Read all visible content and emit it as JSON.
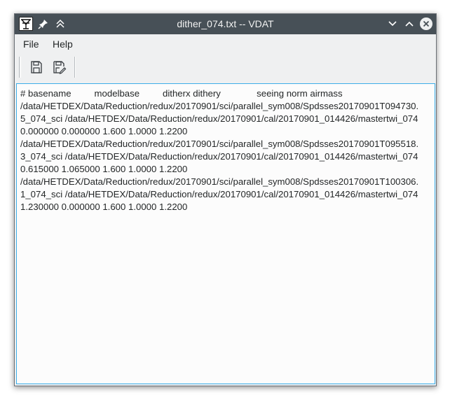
{
  "window": {
    "title": "dither_074.txt -- VDAT"
  },
  "menubar": {
    "file_label": "File",
    "help_label": "Help"
  },
  "toolbar": {
    "save_icon": "save-icon",
    "save_as_icon": "save-as-icon"
  },
  "editor": {
    "lines": [
      "# basename         modelbase         ditherx dithery              seeing norm airmass",
      "/data/HETDEX/Data/Reduction/redux/20170901/sci/parallel_sym008/Spdsses20170901T094730.",
      "5_074_sci /data/HETDEX/Data/Reduction/redux/20170901/cal/20170901_014426/mastertwi_074",
      "0.000000 0.000000 1.600 1.0000 1.2200",
      "/data/HETDEX/Data/Reduction/redux/20170901/sci/parallel_sym008/Spdsses20170901T095518.",
      "3_074_sci /data/HETDEX/Data/Reduction/redux/20170901/cal/20170901_014426/mastertwi_074",
      "0.615000 1.065000 1.600 1.0000 1.2200",
      "/data/HETDEX/Data/Reduction/redux/20170901/sci/parallel_sym008/Spdsses20170901T100306.",
      "1_074_sci /data/HETDEX/Data/Reduction/redux/20170901/cal/20170901_014426/mastertwi_074",
      "1.230000 0.000000 1.600 1.0000 1.2200"
    ]
  },
  "colors": {
    "titlebar": "#475057",
    "focus_border": "#3daee9",
    "window_bg": "#eff0f1"
  }
}
